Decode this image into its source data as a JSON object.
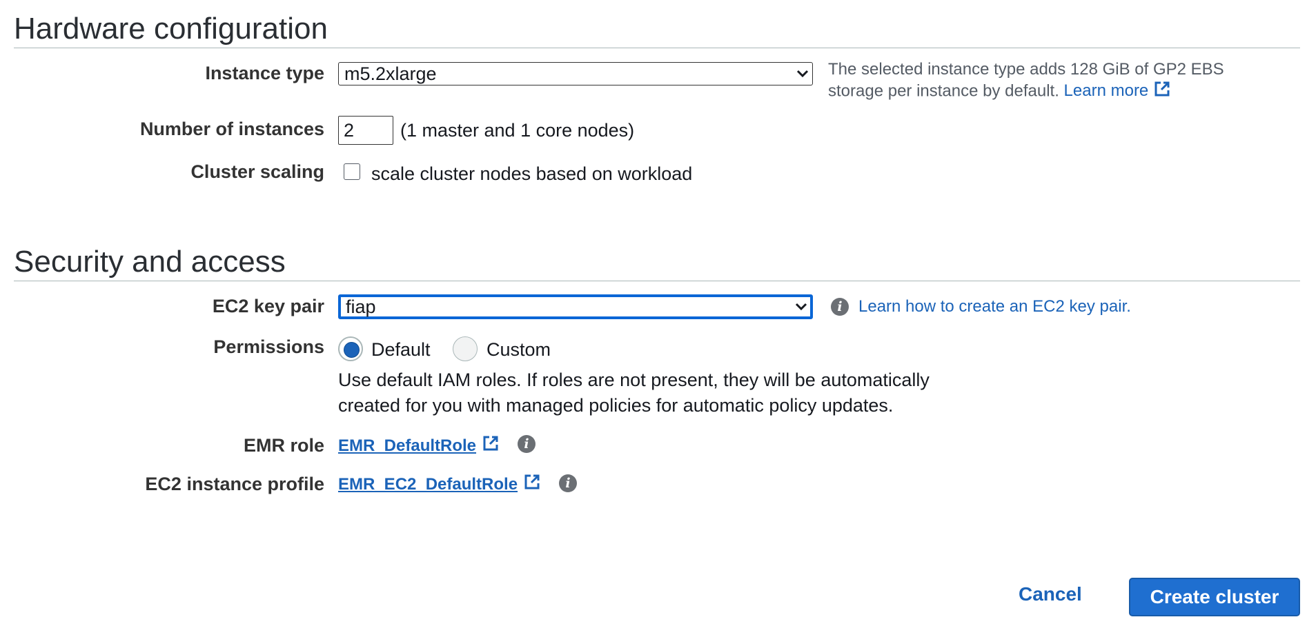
{
  "hardware": {
    "title": "Hardware configuration",
    "instance_type": {
      "label": "Instance type",
      "value": "m5.2xlarge",
      "help_text": "The selected instance type adds 128 GiB of GP2 EBS storage per instance by default.",
      "help_link": "Learn more"
    },
    "instances": {
      "label": "Number of instances",
      "value": "2",
      "note": "(1 master and 1 core nodes)"
    },
    "scaling": {
      "label": "Cluster scaling",
      "checkbox_label": "scale cluster nodes based on workload",
      "checked": false
    }
  },
  "security": {
    "title": "Security and access",
    "key_pair": {
      "label": "EC2 key pair",
      "value": "fiap",
      "help_link": "Learn how to create an EC2 key pair."
    },
    "permissions": {
      "label": "Permissions",
      "options": [
        "Default",
        "Custom"
      ],
      "selected": "Default",
      "description_line1": "Use default IAM roles. If roles are not present, they will be automatically",
      "description_line2": "created for you with managed policies for automatic policy updates."
    },
    "emr_role": {
      "label": "EMR role",
      "value": "EMR_DefaultRole"
    },
    "instance_profile": {
      "label": "EC2 instance profile",
      "value": "EMR_EC2_DefaultRole"
    }
  },
  "footer": {
    "cancel_label": "Cancel",
    "create_label": "Create cluster"
  },
  "colors": {
    "link": "#1b63b8",
    "primary_button": "#1f6fd0",
    "focus_border": "#0a66d6"
  },
  "icons": [
    "chevron-down-icon",
    "external-link-icon",
    "info-icon"
  ]
}
